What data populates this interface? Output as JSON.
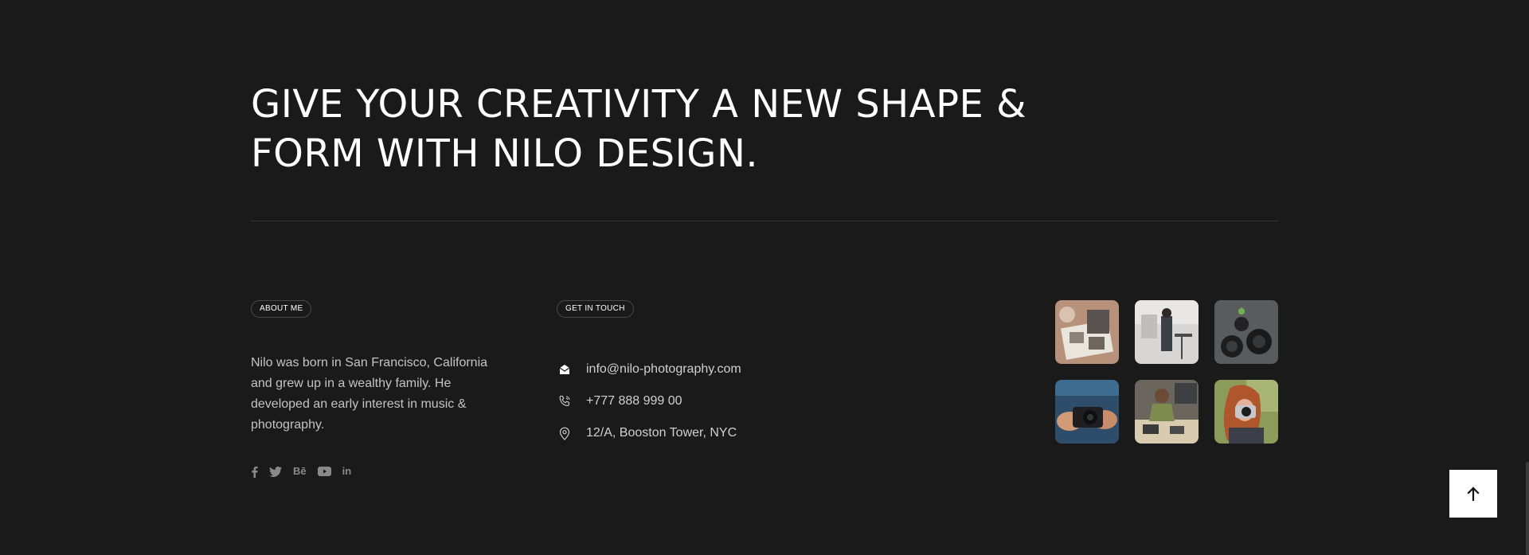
{
  "headline": {
    "line1": "GIVE YOUR CREATIVITY A NEW SHAPE &",
    "line2": "FORM WITH NILO DESIGN."
  },
  "about": {
    "label": "ABOUT ME",
    "text": "Nilo was born in San Francisco, California and grew up in a wealthy family. He developed an early interest in music & photography."
  },
  "socials": [
    {
      "icon": "facebook-icon",
      "glyph": "f"
    },
    {
      "icon": "twitter-icon",
      "glyph": ""
    },
    {
      "icon": "behance-icon",
      "glyph": "Bē"
    },
    {
      "icon": "youtube-icon",
      "glyph": ""
    },
    {
      "icon": "linkedin-icon",
      "glyph": "in"
    }
  ],
  "contact": {
    "label": "GET IN TOUCH",
    "email": "info@nilo-photography.com",
    "phone": "+777 888 999 00",
    "address": "12/A, Booston Tower, NYC"
  },
  "gallery": [
    {
      "icon": "photo-thumbnail-prints-icon"
    },
    {
      "icon": "photo-thumbnail-studio-icon"
    },
    {
      "icon": "photo-thumbnail-lenses-icon"
    },
    {
      "icon": "photo-thumbnail-camera-hands-icon"
    },
    {
      "icon": "photo-thumbnail-woman-desk-icon"
    },
    {
      "icon": "photo-thumbnail-photographer-icon"
    }
  ],
  "colors": {
    "background": "#1a1a1a",
    "text": "#ffffff",
    "muted_text": "#c4c4c4",
    "divider": "#333333",
    "back_to_top_bg": "#ffffff"
  }
}
